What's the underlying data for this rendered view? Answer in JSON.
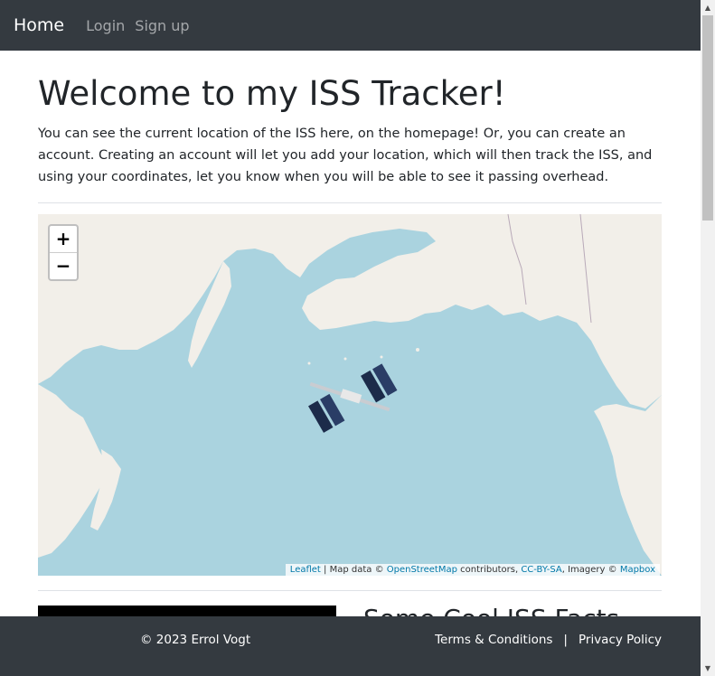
{
  "nav": {
    "brand": "Home",
    "login": "Login",
    "signup": "Sign up"
  },
  "main": {
    "title": "Welcome to my ISS Tracker!",
    "intro": "You can see the current location of the ISS here, on the homepage! Or, you can create an account. Creating an account will let you add your location, which will then track the ISS, and using your coordinates, let you know when you will be able to see it passing overhead."
  },
  "map": {
    "zoom_in": "+",
    "zoom_out": "−",
    "attrib_leaflet": "Leaflet",
    "attrib_mapdata": " | Map data © ",
    "attrib_osm": "OpenStreetMap",
    "attrib_contrib": " contributors, ",
    "attrib_ccbysa": "CC-BY-SA",
    "attrib_imagery": ", Imagery © ",
    "attrib_mapbox": "Mapbox",
    "land_color": "#f2efe9",
    "water_color": "#aad3df",
    "marker_icon": "iss-icon"
  },
  "section": {
    "title": "Some Cool ISS Facts"
  },
  "footer": {
    "copyright": "© 2023 Errol Vogt",
    "terms": "Terms & Conditions",
    "separator": "|",
    "privacy": "Privacy Policy"
  }
}
